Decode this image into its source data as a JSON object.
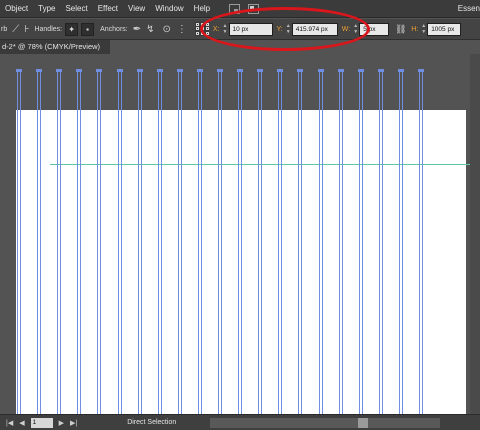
{
  "menubar": {
    "items": [
      "Object",
      "Type",
      "Select",
      "Effect",
      "View",
      "Window",
      "Help"
    ],
    "workspace": "Essen"
  },
  "controlbar": {
    "tool_prefix": "rb",
    "handles_label": "Handles:",
    "anchors_label": "Anchors:",
    "x_label": "X:",
    "x_value": "10 px",
    "y_label": "Y:",
    "y_value": "415.974 px",
    "w_label": "W:",
    "w_value": "5 px",
    "h_label": "H:",
    "h_value": "1005 px"
  },
  "document": {
    "tab_title": "d-2* @ 78% (CMYK/Preview)",
    "column_count": 21
  },
  "statusbar": {
    "zoom_value": "1",
    "tool_name": "Direct Selection"
  },
  "colors": {
    "highlight": "#d8161b",
    "path_blue": "#6f8ee0",
    "guide_green": "#5fc8a0",
    "coord_label": "#f0a030"
  }
}
